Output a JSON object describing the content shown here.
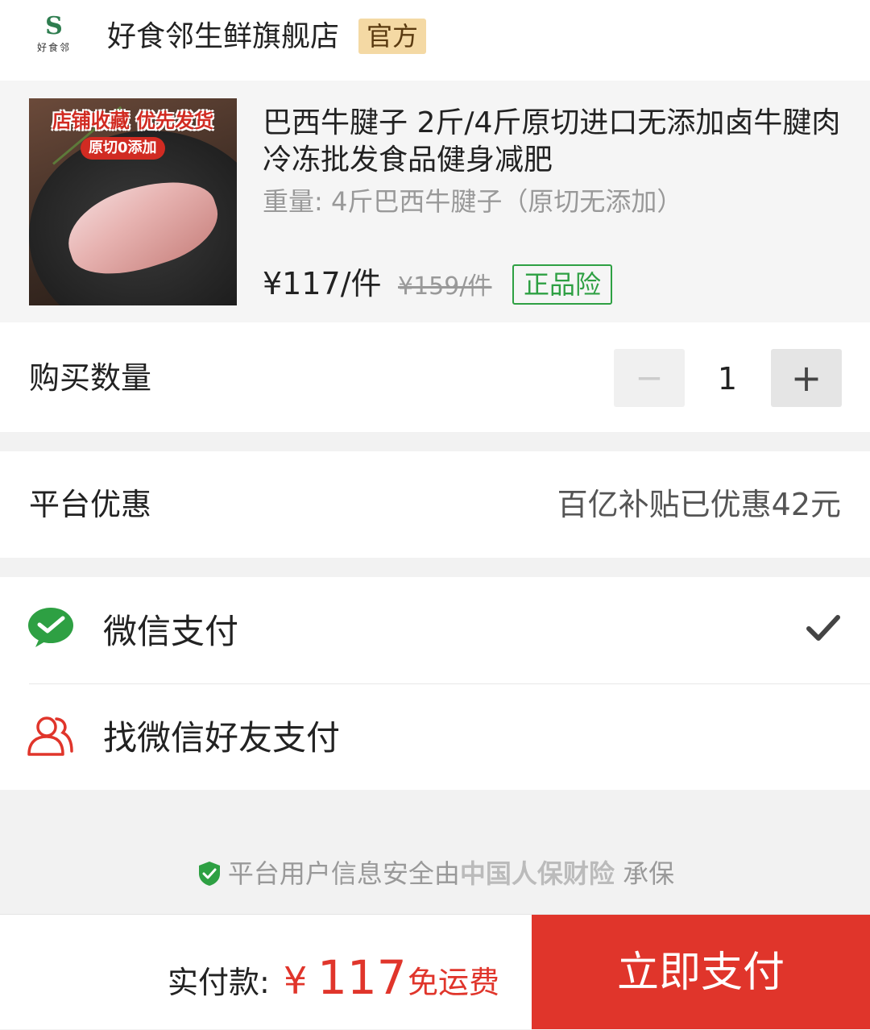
{
  "store": {
    "logo_mark": "S",
    "logo_text": "好食邻",
    "name": "好食邻生鲜旗舰店",
    "badge": "官方"
  },
  "product": {
    "image_banner": "店铺收藏 优先发货",
    "image_sub": "原切0添加",
    "title": "巴西牛腱子 2斤/4斤原切进口无添加卤牛腱肉冷冻批发食品健身减肥",
    "spec": "重量: 4斤巴西牛腱子（原切无添加）",
    "price": "¥117/件",
    "original_price": "¥159/件",
    "badge": "正品险"
  },
  "quantity": {
    "label": "购买数量",
    "minus": "−",
    "value": "1",
    "plus": "+"
  },
  "discount": {
    "label": "平台优惠",
    "value": "百亿补贴已优惠42元"
  },
  "payment": {
    "wechat_label": "微信支付",
    "friend_label": "找微信好友支付",
    "selected": "wechat"
  },
  "security": {
    "prefix": "平台用户信息安全由",
    "brand": "中国人保财险",
    "suffix": "承保"
  },
  "footer": {
    "total_label": "实付款:",
    "currency": "¥",
    "amount": "117",
    "shipping": "免运费",
    "pay_button": "立即支付"
  },
  "colors": {
    "accent_red": "#e0352b",
    "wechat_green": "#2ea043",
    "official_badge_bg": "#f4d9a4"
  }
}
